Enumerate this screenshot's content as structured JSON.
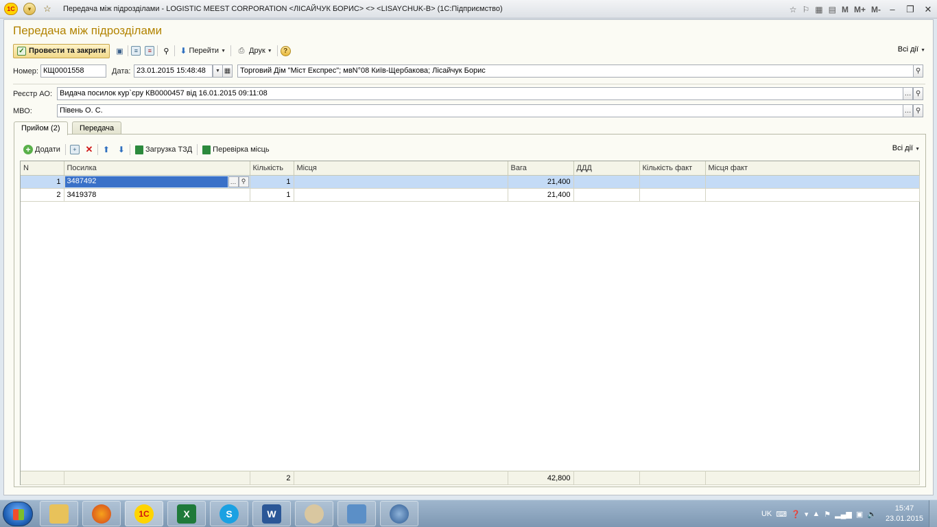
{
  "window": {
    "title": "Передача між підрозділами - LOGISTIC MEEST CORPORATION    <ЛІСАЙЧУК БОРИС>  <>  <LISAYCHUK-B>  (1С:Підприємство)",
    "right_controls": [
      "M",
      "M+",
      "M-"
    ]
  },
  "doc": {
    "title": "Передача між підрозділами"
  },
  "toolbar": {
    "post_close": "Провести та закрити",
    "goto": "Перейти",
    "print": "Друк",
    "all_actions": "Всі дії"
  },
  "form": {
    "number_label": "Номер:",
    "number_value": "КЩ0001558",
    "date_label": "Дата:",
    "date_value": "23.01.2015 15:48:48",
    "org_value": "Торговий Дім \"Міст Експрес\"; мвN°08 Київ-Щербакова; Лісайчук Борис",
    "registry_label": "Реєстр АО:",
    "registry_value": "Видача посилок кур`єру КВ0000457 від 16.01.2015 09:11:08",
    "mvo_label": "МВО:",
    "mvo_value": "Півень О. С."
  },
  "tabs": [
    {
      "label": "Прийом (2)",
      "active": true
    },
    {
      "label": "Передача",
      "active": false
    }
  ],
  "table_toolbar": {
    "add": "Додати",
    "load_tsd": "Загрузка ТЗД",
    "check_places": "Перевірка місць",
    "all_actions": "Всі дії"
  },
  "table": {
    "columns": [
      "N",
      "Посилка",
      "Кількість",
      "Місця",
      "Вага",
      "ДДД",
      "Кількість факт",
      "Місця факт"
    ],
    "rows": [
      {
        "n": "1",
        "parcel": "3487492",
        "qty": "1",
        "places": "",
        "weight": "21,400",
        "ddd": "",
        "qty_fact": "",
        "places_fact": ""
      },
      {
        "n": "2",
        "parcel": "3419378",
        "qty": "1",
        "places": "",
        "weight": "21,400",
        "ddd": "",
        "qty_fact": "",
        "places_fact": ""
      }
    ],
    "totals": {
      "qty": "2",
      "weight": "42,800"
    }
  },
  "taskbar": {
    "lang": "UK",
    "time": "15:47",
    "date": "23.01.2015"
  }
}
